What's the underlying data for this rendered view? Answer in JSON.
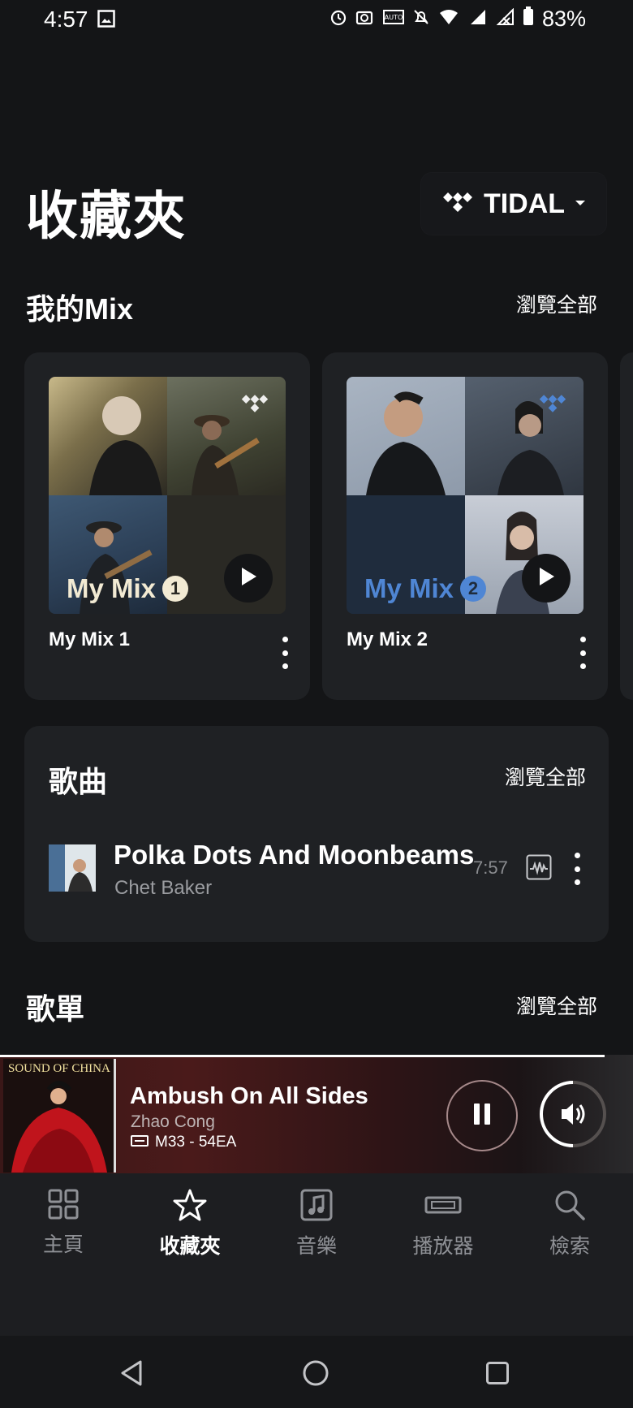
{
  "status_bar": {
    "time": "4:57",
    "battery": "83%"
  },
  "header": {
    "title": "收藏夾",
    "service": "TIDAL"
  },
  "mixes": {
    "title": "我的Mix",
    "browse_label": "瀏覽全部",
    "items": [
      {
        "name": "My Mix 1",
        "art_label": "My Mix",
        "art_number": "1",
        "accent": "#f2ead3"
      },
      {
        "name": "My Mix 2",
        "art_label": "My Mix",
        "art_number": "2",
        "accent": "#4f86d4"
      }
    ]
  },
  "songs": {
    "title": "歌曲",
    "browse_label": "瀏覽全部",
    "track": {
      "title": "Polka Dots And Moonbeams",
      "artist": "Chet Baker",
      "duration": "7:57"
    }
  },
  "playlists": {
    "title": "歌單",
    "browse_label": "瀏覽全部"
  },
  "now_playing": {
    "album_text": "SOUND OF CHINA",
    "title": "Ambush On All Sides",
    "artist": "Zhao Cong",
    "zone": "M33 - 54EA"
  },
  "nav": {
    "items": [
      {
        "label": "主頁",
        "icon": "home-grid-icon"
      },
      {
        "label": "收藏夾",
        "icon": "star-icon",
        "active": true
      },
      {
        "label": "音樂",
        "icon": "music-note-icon"
      },
      {
        "label": "播放器",
        "icon": "player-device-icon"
      },
      {
        "label": "檢索",
        "icon": "search-icon"
      }
    ]
  },
  "colors": {
    "background": "#141517",
    "card": "#1f2124",
    "muted": "#9a9ca0"
  }
}
